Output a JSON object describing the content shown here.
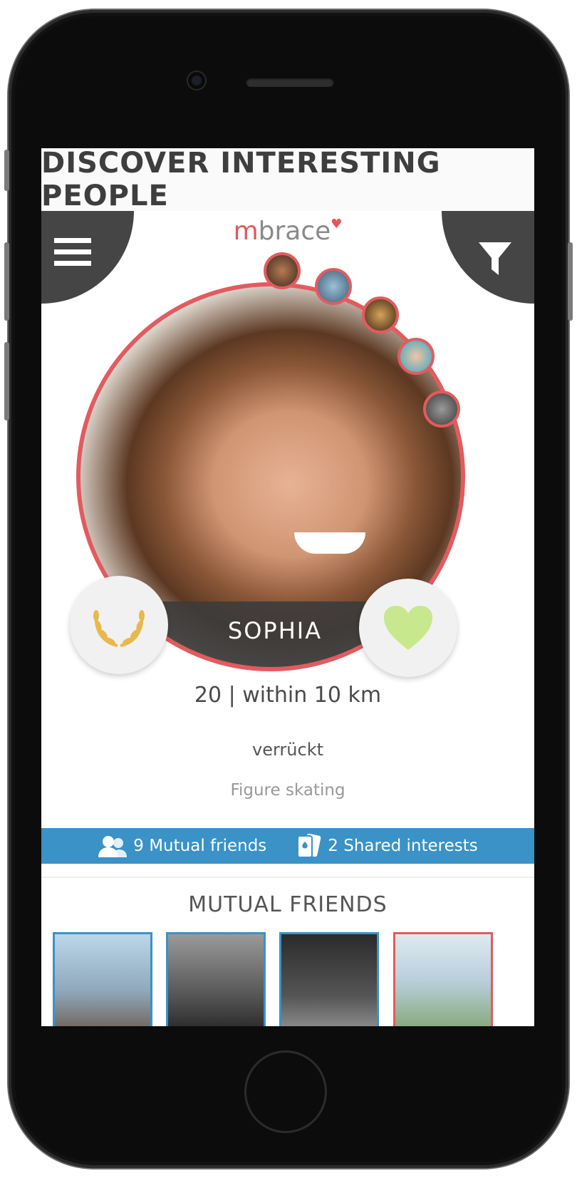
{
  "banner": {
    "headline": "DISCOVER INTERESTING PEOPLE"
  },
  "app": {
    "logo_m": "m",
    "logo_rest": "brace",
    "logo_heart": "♥"
  },
  "profile": {
    "name": "SOPHIA",
    "age_distance": "20 | within 10 km",
    "tagline": "verrückt",
    "interest": "Figure skating"
  },
  "stats": {
    "mutual_friends": "9 Mutual friends",
    "shared_interests": "2 Shared interests"
  },
  "sections": {
    "mutual_friends_title": "MUTUAL FRIENDS"
  },
  "icons": {
    "menu": "hamburger-menu-icon",
    "filter": "filter-funnel-icon",
    "award": "laurel-wreath-icon",
    "like": "heart-icon",
    "friends": "people-icon",
    "interests": "playing-cards-icon"
  },
  "colors": {
    "accent": "#e25b5f",
    "bar": "#3a92c7",
    "dark": "#454545",
    "like": "#c7e88d",
    "award": "#e8b84a"
  }
}
